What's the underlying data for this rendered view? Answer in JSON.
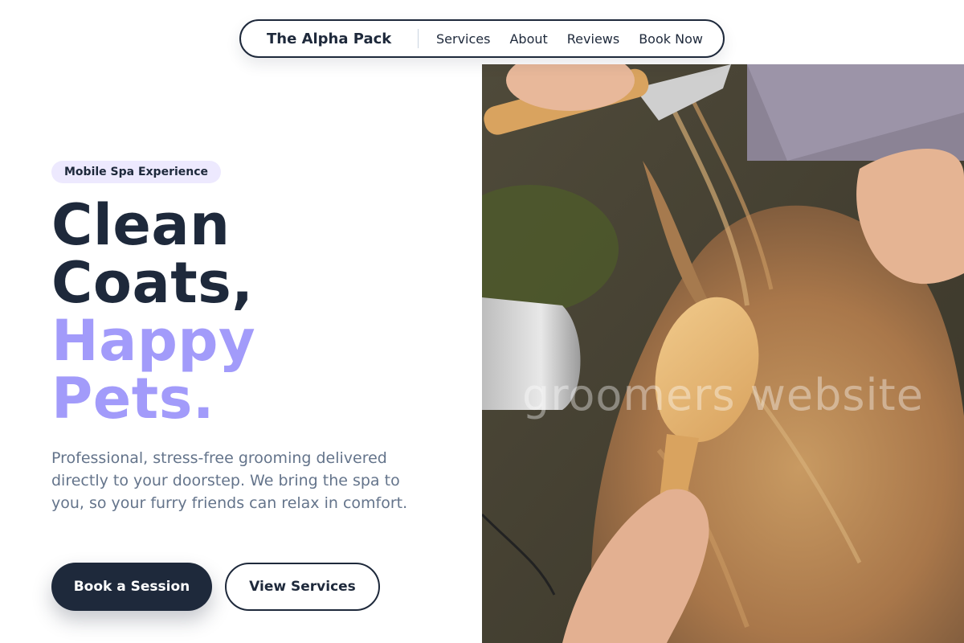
{
  "nav": {
    "brand": "The Alpha Pack",
    "links": [
      {
        "label": "Services"
      },
      {
        "label": "About"
      },
      {
        "label": "Reviews"
      },
      {
        "label": "Book Now"
      }
    ]
  },
  "hero": {
    "badge": "Mobile Spa Experience",
    "headline_dark": [
      "Clean",
      "Coats,"
    ],
    "headline_accent": [
      "Happy",
      "Pets."
    ],
    "description": "Professional, stress-free grooming delivered directly to your doorstep. We bring the spa to you, so your furry friends can relax in comfort.",
    "primary_button": "Book a Session",
    "secondary_button": "View Services"
  },
  "image": {
    "subject": "dog-grooming-brush-photo",
    "watermark": "groomers website"
  },
  "colors": {
    "navy": "#1e293b",
    "accent": "#a29bfa",
    "badge_bg": "#ede9fe",
    "muted_text": "#64748b"
  }
}
